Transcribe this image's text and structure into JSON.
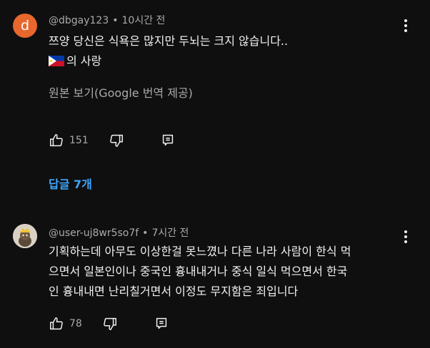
{
  "comments": [
    {
      "avatar_letter": "d",
      "avatar_color": "#e8672d",
      "username": "@dbgay123",
      "separator": "•",
      "time": "10시간 전",
      "text_line1": "쯔양 당신은 식욕은 많지만 두뇌는 크지 않습니다..",
      "text_line2": "의 사랑",
      "flag_icon": "philippines-flag",
      "translate_label": "원본 보기(Google 번역 제공)",
      "likes": "151",
      "replies_label": "답글 7개"
    },
    {
      "username": "@user-uj8wr5so7f",
      "separator": "•",
      "time": "7시간 전",
      "text_lines": [
        "기획하는데 아무도 이상한걸 못느꼈나 다른 나라 사람이 한식 먹",
        "으면서 일본인이나 중국인 흉내내거나 중식 일식 먹으면서 한국",
        "인 흉내내면 난리칠거면서 이정도 무지함은 죄입니다"
      ],
      "likes": "78"
    }
  ],
  "colors": {
    "background": "#0f0f0f",
    "text": "#f1f1f1",
    "secondary": "#aaaaaa",
    "link": "#3ea6ff"
  }
}
